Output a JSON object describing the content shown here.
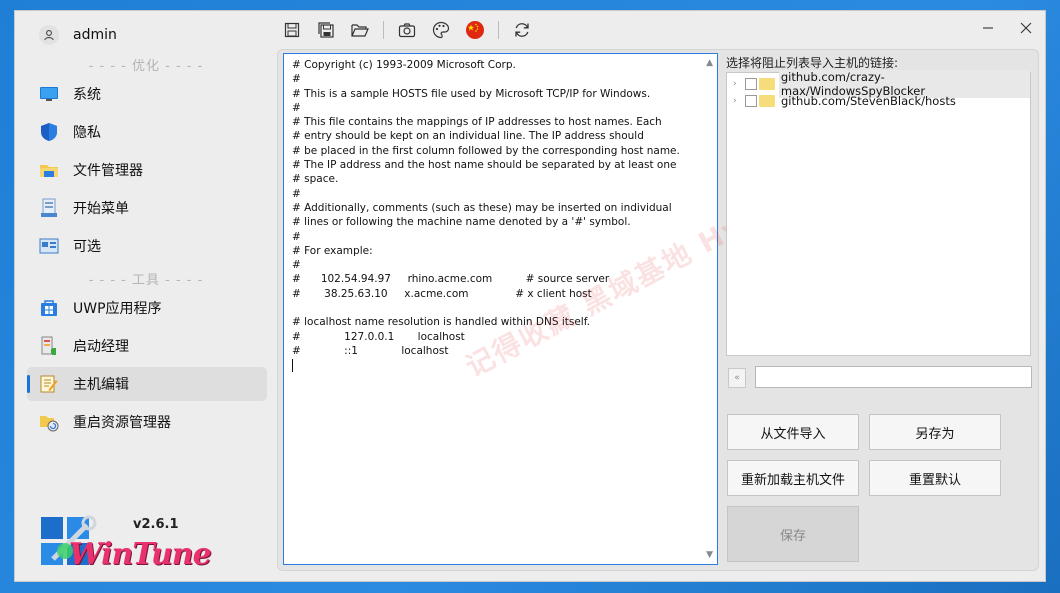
{
  "sidebar": {
    "user": "admin",
    "section_optimize": "- - - - 优化 - - - -",
    "section_tools": "- - - - 工具 - - - -",
    "items": [
      {
        "label": "系统",
        "icon": "monitor-icon"
      },
      {
        "label": "隐私",
        "icon": "shield-icon"
      },
      {
        "label": "文件管理器",
        "icon": "folder-icon"
      },
      {
        "label": "开始菜单",
        "icon": "start-menu-icon"
      },
      {
        "label": "可选",
        "icon": "optional-icon"
      },
      {
        "label": "UWP应用程序",
        "icon": "windows-store-icon"
      },
      {
        "label": "启动经理",
        "icon": "startup-icon"
      },
      {
        "label": "主机编辑",
        "icon": "edit-icon"
      },
      {
        "label": "重启资源管理器",
        "icon": "restart-explorer-icon"
      }
    ],
    "version": "v2.6.1",
    "logo_text": "WinTune"
  },
  "toolbar": {
    "buttons": [
      "save-icon",
      "save-all-icon",
      "open-folder-icon",
      "screenshot-icon",
      "theme-icon",
      "china-flag-icon",
      "refresh-icon"
    ]
  },
  "editor": {
    "content": "# Copyright (c) 1993-2009 Microsoft Corp.\n#\n# This is a sample HOSTS file used by Microsoft TCP/IP for Windows.\n#\n# This file contains the mappings of IP addresses to host names. Each\n# entry should be kept on an individual line. The IP address should\n# be placed in the first column followed by the corresponding host name.\n# The IP address and the host name should be separated by at least one\n# space.\n#\n# Additionally, comments (such as these) may be inserted on individual\n# lines or following the machine name denoted by a '#' symbol.\n#\n# For example:\n#\n#      102.54.94.97     rhino.acme.com          # source server\n#       38.25.63.10     x.acme.com              # x client host\n\n# localhost name resolution is handled within DNS itself.\n#             127.0.0.1       localhost\n#             ::1             localhost\n"
  },
  "watermark": "记得收藏 黑域基地 Hybase.com",
  "blocklist": {
    "title": "选择将阻止列表导入主机的链接:",
    "items": [
      {
        "label": "github.com/crazy-max/WindowsSpyBlocker",
        "selected": true
      },
      {
        "label": "github.com/StevenBlack/hosts",
        "selected": false
      }
    ],
    "search_value": ""
  },
  "buttons": {
    "import_file": "从文件导入",
    "save_as": "另存为",
    "reload": "重新加载主机文件",
    "reset": "重置默认",
    "save": "保存"
  },
  "colors": {
    "accent": "#1a73d9",
    "logo": "#e9316d"
  }
}
